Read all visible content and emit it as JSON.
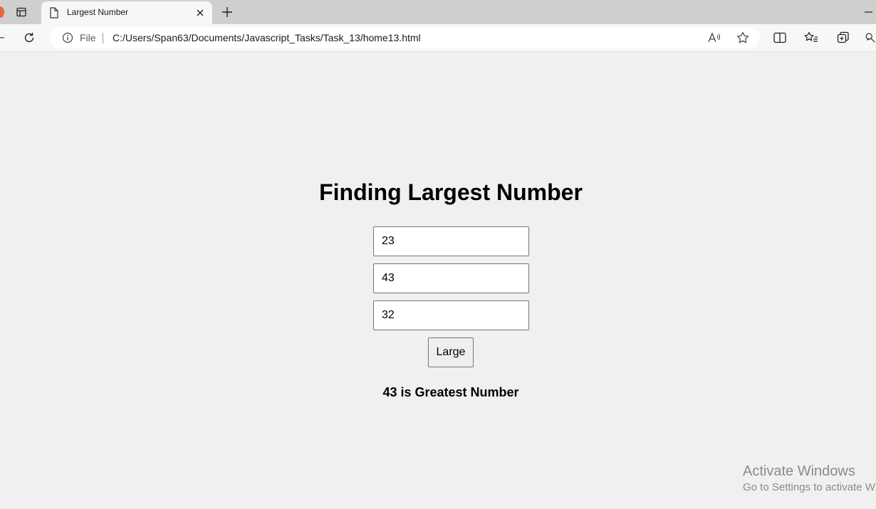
{
  "browser": {
    "tab": {
      "title": "Largest Number"
    },
    "address_bar": {
      "site_label": "File",
      "url": "C:/Users/Span63/Documents/Javascript_Tasks/Task_13/home13.html"
    }
  },
  "page": {
    "heading": "Finding Largest Number",
    "inputs": [
      "23",
      "43",
      "32"
    ],
    "button_label": "Large",
    "result": "43 is Greatest Number"
  },
  "watermark": {
    "title": "Activate Windows",
    "subtitle": "Go to Settings to activate W"
  }
}
